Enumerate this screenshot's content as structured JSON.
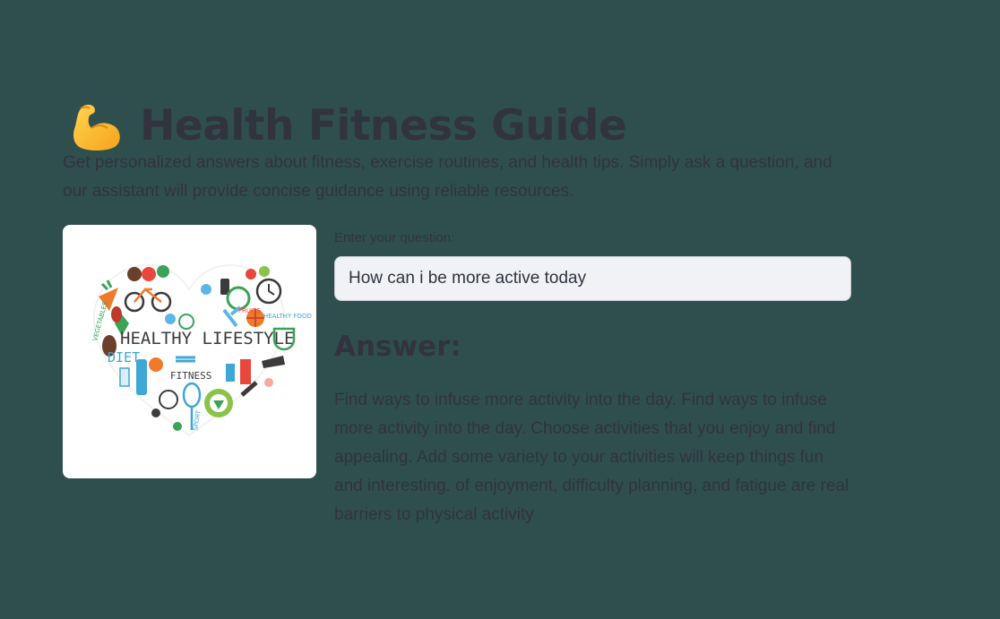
{
  "header": {
    "icon": "flexed-biceps-icon",
    "title": "Health Fitness Guide"
  },
  "intro": {
    "description": "Get personalized answers about fitness, exercise routines, and health tips. Simply ask a question, and our assistant will provide concise guidance using reliable resources."
  },
  "image": {
    "icon": "healthy-lifestyle-heart-illustration",
    "caption_main": "HEALTHY LIFESTYLE",
    "caption_diet": "DIET",
    "caption_fitness": "FITNESS",
    "caption_vegetables": "VEGETABLES",
    "caption_fruits": "FRUITS",
    "caption_healthy_food": "HEALTHY FOOD",
    "caption_sport": "SPORT"
  },
  "question": {
    "label": "Enter your question:",
    "value": "How can i be more active today",
    "placeholder": ""
  },
  "answer": {
    "heading": "Answer:",
    "text": "Find ways to infuse more activity into the day. Find ways to infuse more activity into the day. Choose activities that you enjoy and find appealing. Add some variety to your activities will keep things fun and interesting. of enjoyment, difficulty planning, and fatigue are real barriers to physical activity"
  },
  "colors": {
    "background": "#2f4f4f",
    "text": "#31333f",
    "input_background": "#f0f2f6",
    "card_background": "#ffffff"
  }
}
